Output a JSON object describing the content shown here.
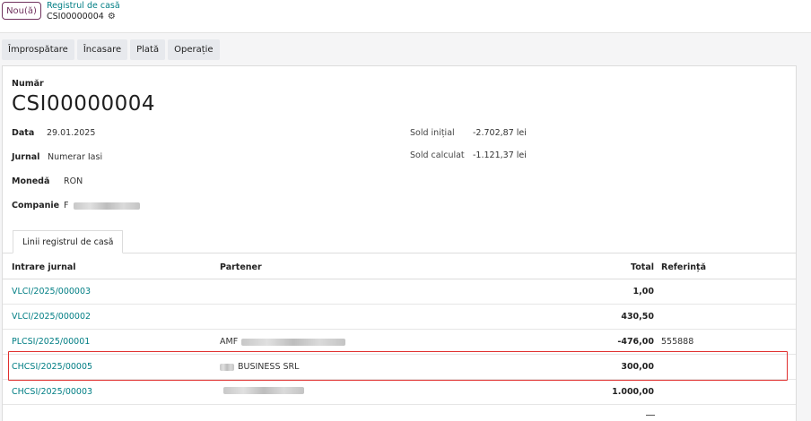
{
  "header": {
    "new_button": "Nou(ă)",
    "breadcrumb_parent": "Registrul de casă",
    "breadcrumb_current": "CSI00000004",
    "settings_icon": "gear-icon"
  },
  "actions": [
    "Împrospătare",
    "Încasare",
    "Plată",
    "Operație"
  ],
  "form": {
    "number_label": "Număr",
    "number_value": "CSI00000004",
    "date_label": "Data",
    "date_value": "29.01.2025",
    "journal_label": "Jurnal",
    "journal_value": "Numerar Iasi",
    "currency_label": "Monedă",
    "currency_value": "RON",
    "company_label": "Companie",
    "company_value_prefix": "F",
    "initial_balance_label": "Sold inițial",
    "initial_balance_value": "-2.702,87 lei",
    "computed_balance_label": "Sold calculat",
    "computed_balance_value": "-1.121,37 lei"
  },
  "tab": {
    "label": "Linii registrul de casă"
  },
  "table": {
    "columns": {
      "entry": "Intrare jurnal",
      "partner": "Partener",
      "total": "Total",
      "reference": "Referință"
    },
    "rows": [
      {
        "entry": "VLCI/2025/000003",
        "partner": "",
        "total": "1,00",
        "reference": ""
      },
      {
        "entry": "VLCI/2025/000002",
        "partner": "",
        "total": "430,50",
        "reference": ""
      },
      {
        "entry": "PLCSI/2025/00001",
        "partner": "AMF",
        "total": "-476,00",
        "reference": "555888"
      },
      {
        "entry": "CHCSI/2025/00005",
        "partner": "BUSINESS SRL",
        "total": "300,00",
        "reference": ""
      },
      {
        "entry": "CHCSI/2025/00003",
        "partner": "",
        "total": "1.000,00",
        "reference": ""
      }
    ]
  },
  "colors": {
    "link": "#017e84",
    "brand": "#71335f",
    "highlight": "#e0302f"
  }
}
